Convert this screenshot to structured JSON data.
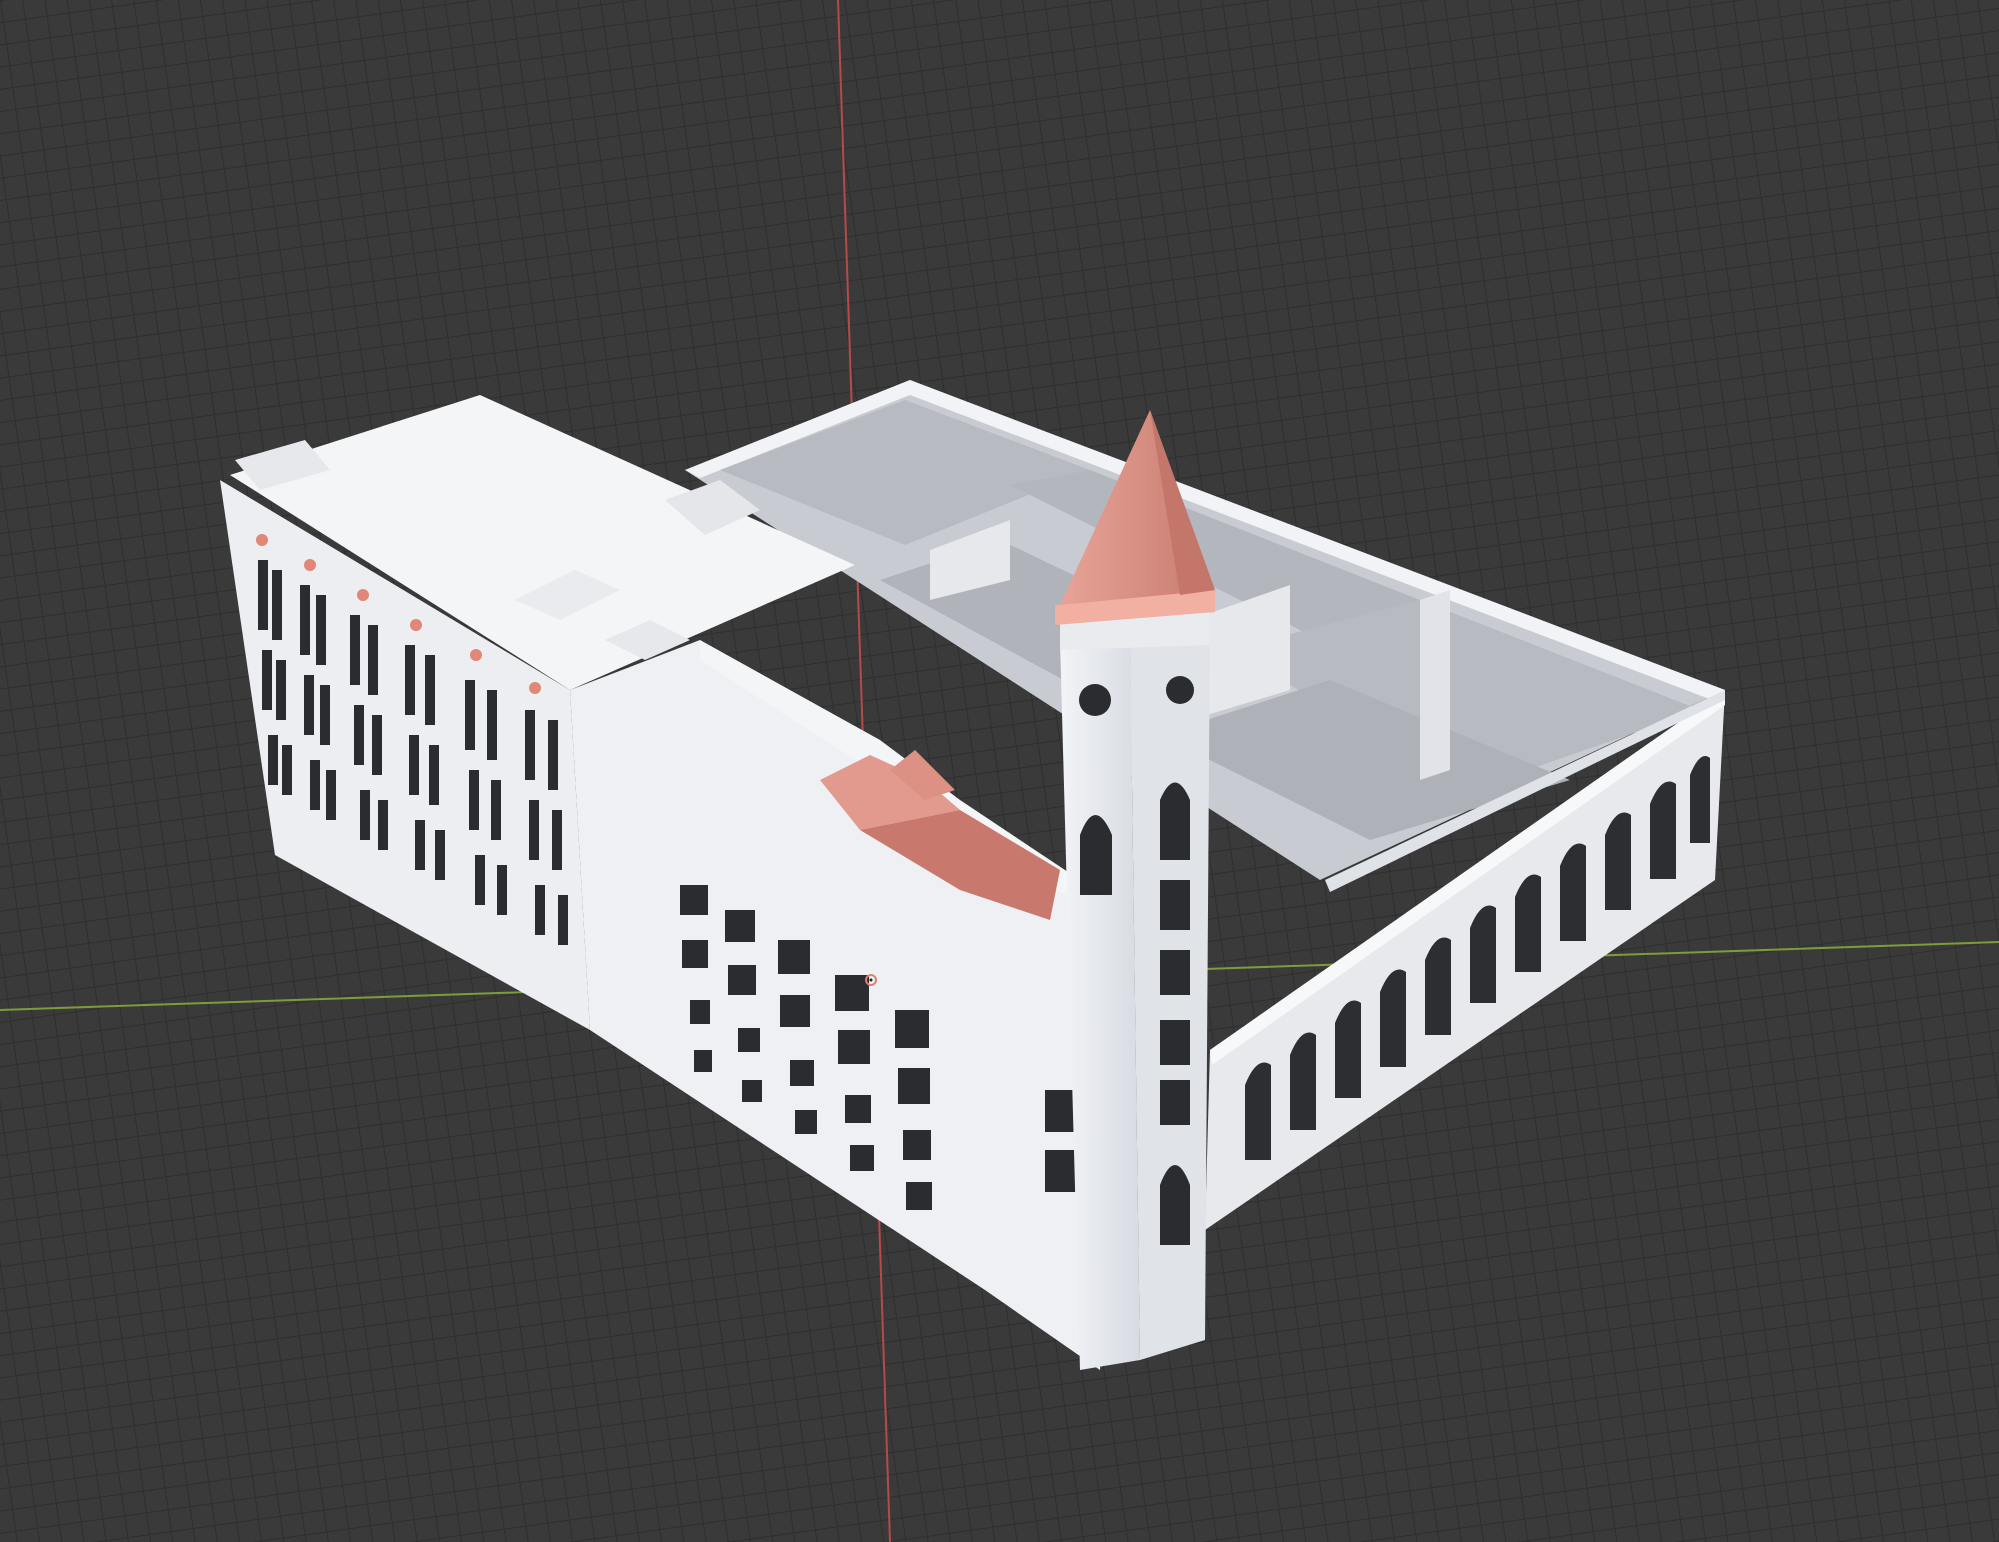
{
  "viewport": {
    "view": "perspective",
    "object": "building-model",
    "colors": {
      "background": "#3a3a3a",
      "grid": "#2e2e2e",
      "x_axis": "#7e9c3a",
      "y_axis": "#b64a4a",
      "wall": "#eef0f4",
      "wall_shade": "#d8dce3",
      "roof": "#b9bcc3",
      "roof_shade": "#a3a6ad",
      "accent_roof": "#e39a8e",
      "accent_roof_shade": "#c9786d",
      "window": "#2a2c30",
      "origin_marker": "#d9826f"
    }
  }
}
